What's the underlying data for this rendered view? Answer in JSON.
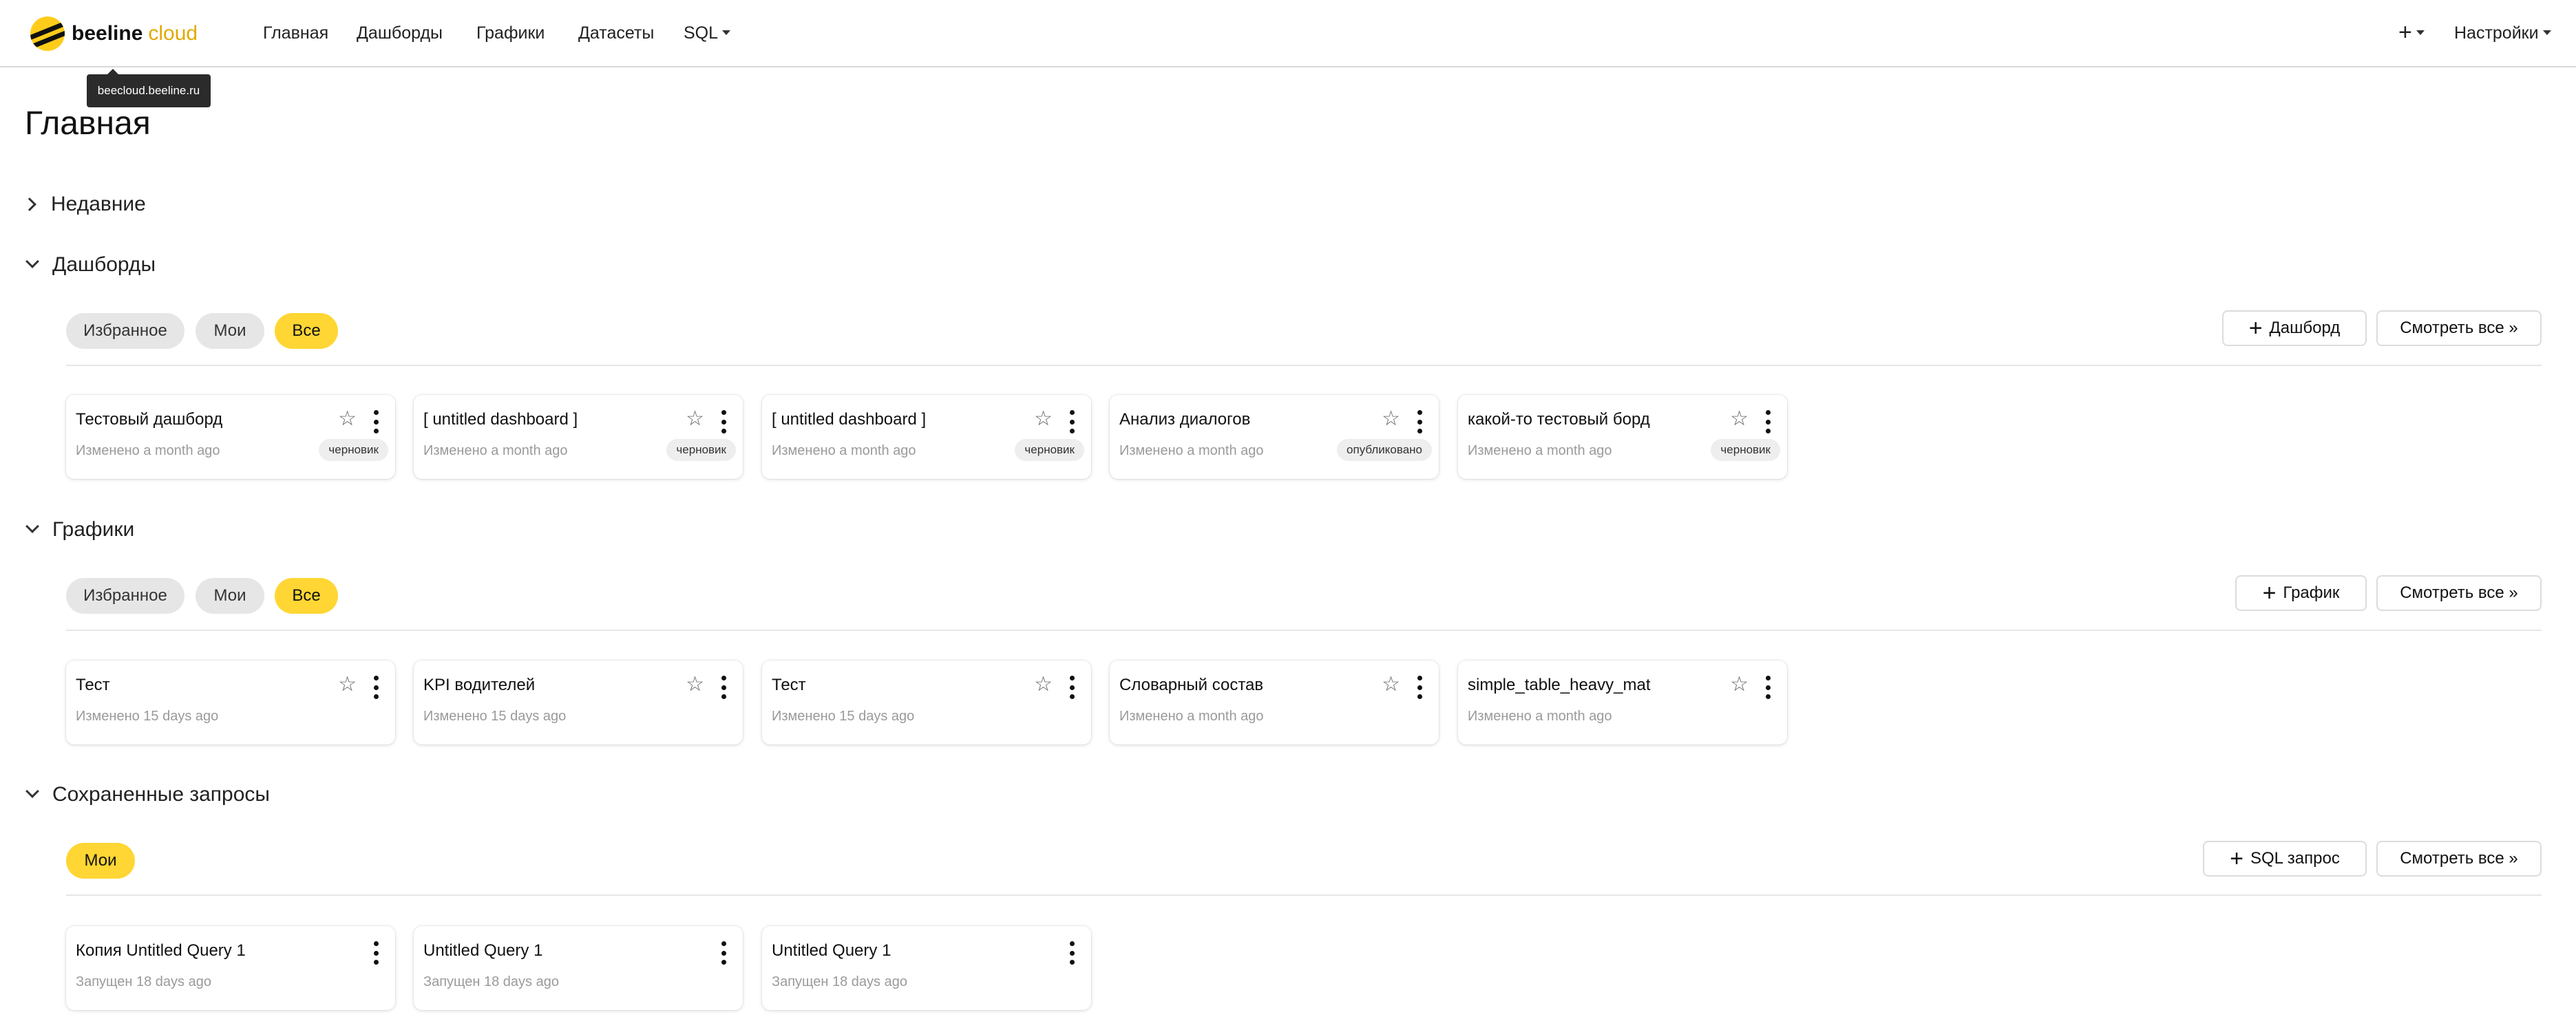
{
  "header": {
    "logo": {
      "word1": "beeline",
      "word2": "cloud"
    },
    "nav": [
      "Главная",
      "Дашборды",
      "Графики",
      "Датасеты",
      "SQL"
    ],
    "settings_label": "Настройки",
    "tooltip": "beecloud.beeline.ru"
  },
  "page_title": "Главная",
  "sections": {
    "recent": {
      "title": "Недавние"
    },
    "dashboards": {
      "title": "Дашборды",
      "filters": [
        "Избранное",
        "Мои",
        "Все"
      ],
      "add_label": "Дашборд",
      "view_all": "Смотреть все »",
      "cards": [
        {
          "title": "Тестовый дашборд",
          "sub": "Изменено a month ago",
          "badge": "черновик"
        },
        {
          "title": "[ untitled dashboard ]",
          "sub": "Изменено a month ago",
          "badge": "черновик"
        },
        {
          "title": "[ untitled dashboard ]",
          "sub": "Изменено a month ago",
          "badge": "черновик"
        },
        {
          "title": "Анализ диалогов",
          "sub": "Изменено a month ago",
          "badge": "опубликовано"
        },
        {
          "title": "какой-то тестовый борд",
          "sub": "Изменено a month ago",
          "badge": "черновик"
        }
      ]
    },
    "charts": {
      "title": "Графики",
      "filters": [
        "Избранное",
        "Мои",
        "Все"
      ],
      "add_label": "График",
      "view_all": "Смотреть все »",
      "cards": [
        {
          "title": "Тест",
          "sub": "Изменено 15 days ago"
        },
        {
          "title": "KPI водителей",
          "sub": "Изменено 15 days ago"
        },
        {
          "title": "Тест",
          "sub": "Изменено 15 days ago"
        },
        {
          "title": "Словарный состав",
          "sub": "Изменено a month ago"
        },
        {
          "title": "simple_table_heavy_mat",
          "sub": "Изменено a month ago"
        }
      ]
    },
    "queries": {
      "title": "Сохраненные запросы",
      "filters": [
        "Мои"
      ],
      "add_label": "SQL запрос",
      "view_all": "Смотреть все »",
      "cards": [
        {
          "title": "Копия Untitled Query 1",
          "sub": "Запущен 18 days ago"
        },
        {
          "title": "Untitled Query 1",
          "sub": "Запущен 18 days ago"
        },
        {
          "title": "Untitled Query 1",
          "sub": "Запущен 18 days ago"
        }
      ]
    }
  },
  "colors": {
    "accent": "#ffd633",
    "brand_yellow": "#ffcc1a",
    "pill_bg": "#e6e6e6"
  }
}
